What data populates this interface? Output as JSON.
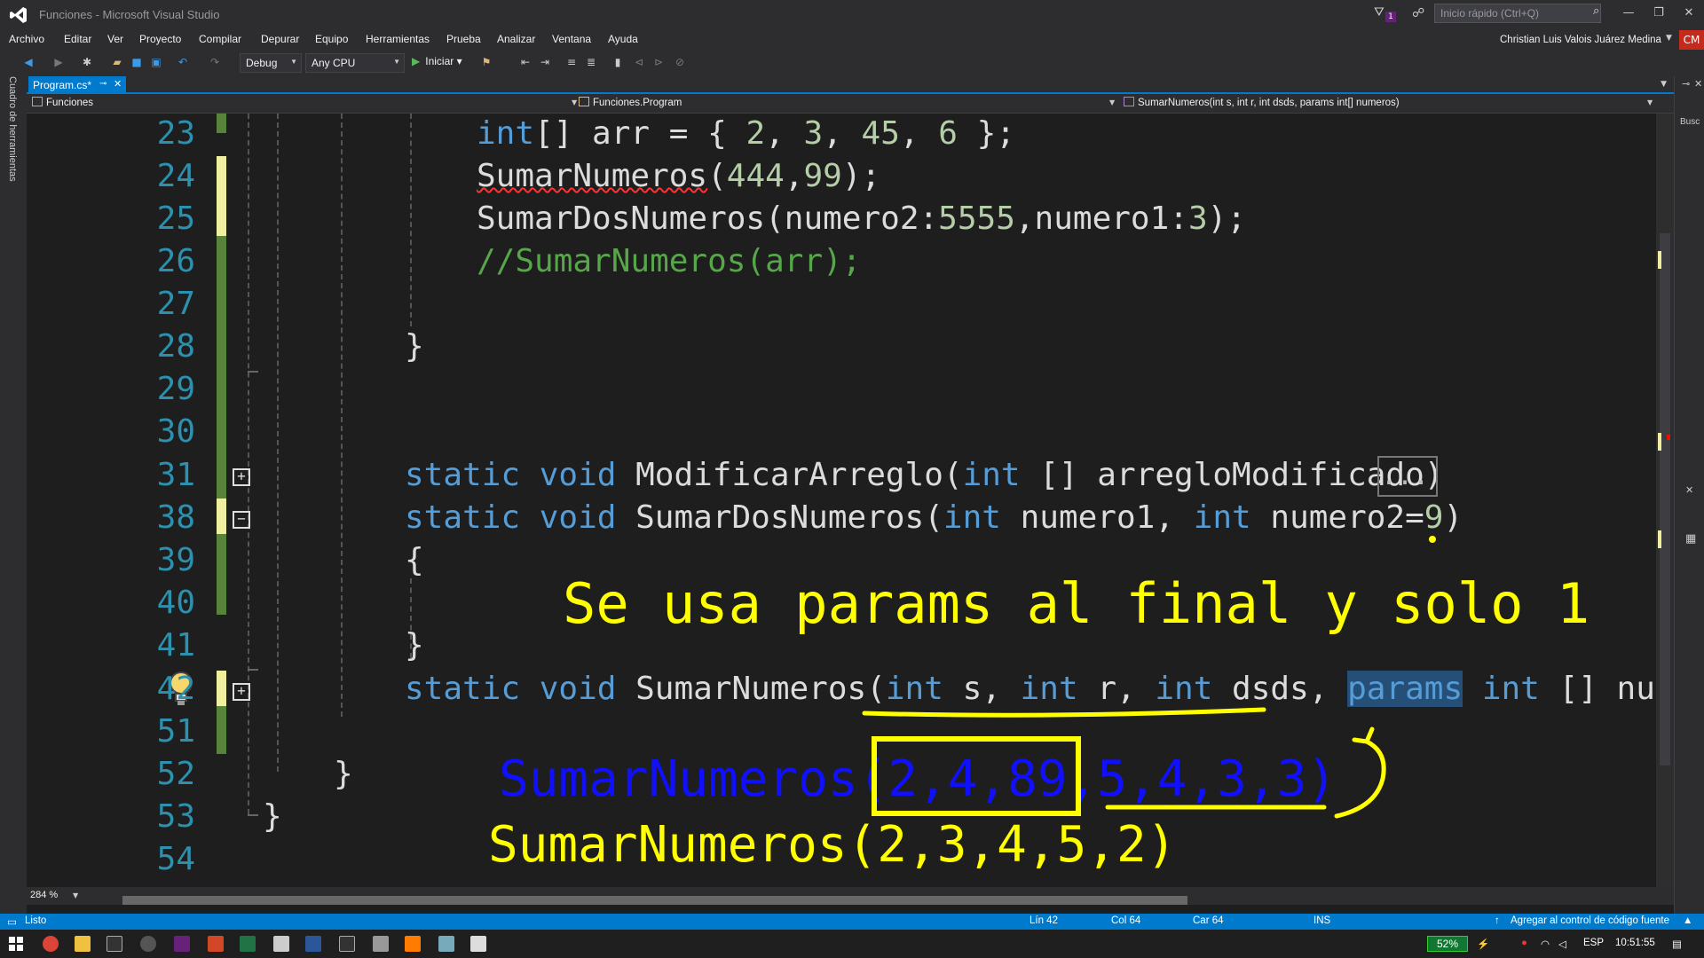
{
  "window": {
    "title": "Funciones - Microsoft Visual Studio",
    "quick_launch_placeholder": "Inicio rápido (Ctrl+Q)",
    "notification_count": "1"
  },
  "menu": [
    "Archivo",
    "Editar",
    "Ver",
    "Proyecto",
    "Compilar",
    "Depurar",
    "Equipo",
    "Herramientas",
    "Prueba",
    "Analizar",
    "Ventana",
    "Ayuda"
  ],
  "user": {
    "name": "Christian Luis Valois Juárez Medina",
    "initials": "CM"
  },
  "toolbar": {
    "config": "Debug",
    "platform": "Any CPU",
    "start_label": "Iniciar"
  },
  "toolbox_label": "Cuadro de herramientas",
  "tab": {
    "label": "Program.cs*"
  },
  "navbar": {
    "project": "Funciones",
    "class": "Funciones.Program",
    "member": "SumarNumeros(int s, int r, int dsds, params int[] numeros)"
  },
  "right_panel_label": "Busc",
  "editor": {
    "line_numbers": [
      "23",
      "24",
      "25",
      "26",
      "27",
      "28",
      "29",
      "30",
      "31",
      "38",
      "39",
      "40",
      "41",
      "42",
      "51",
      "52",
      "53",
      "54"
    ],
    "lines": {
      "l23": {
        "a": "int",
        "b": "[] arr = { ",
        "c": "2",
        "d": ", ",
        "e": "3",
        "f": ", ",
        "g": "45",
        "h": ", ",
        "i": "6",
        "j": " };"
      },
      "l24": {
        "a": "SumarNumeros",
        "b": "(",
        "c": "444",
        "d": ",",
        "e": "99",
        "f": ");"
      },
      "l25": {
        "a": "SumarDosNumeros(numero2:",
        "b": "5555",
        "c": ",numero1:",
        "d": "3",
        "e": ");"
      },
      "l26": "//SumarNumeros(arr);",
      "l28": "}",
      "l31": {
        "a": "static",
        "b": " ",
        "c": "void",
        "d": " ModificarArreglo(",
        "e": "int",
        "f": " [] arregloModificado)",
        "collapsed": "..."
      },
      "l38": {
        "a": "static",
        "b": " ",
        "c": "void",
        "d": " SumarDosNumeros(",
        "e": "int",
        "f": " numero1, ",
        "g": "int",
        "h": " numero2=",
        "i": "9",
        "j": ")"
      },
      "l39": "{",
      "l41": "}",
      "l42": {
        "a": "static",
        "b": " ",
        "c": "void",
        "d": " SumarNumeros(",
        "e": "int",
        "f": " s, ",
        "g": "int",
        "h": " r, ",
        "i": "int",
        "j": " dsds, ",
        "k": "params",
        "l": " ",
        "m": "int",
        "n": " [] numero"
      },
      "l52": "}",
      "l53": "}"
    }
  },
  "annotations": {
    "note": "Se usa params al final y solo 1",
    "blue_call": "SumarNumeros(2,4,89,5,4,3,3)",
    "yellow_call": "SumarNumeros(2,3,4,5,2)"
  },
  "zoom": "284 %",
  "status": {
    "state": "Listo",
    "line": "Lín 42",
    "col": "Col 64",
    "car": "Car 64",
    "mode": "INS",
    "source_control": "Agregar al control de código fuente"
  },
  "taskbar": {
    "battery": "52%",
    "lang": "ESP",
    "time": "10:51:55"
  },
  "colors": {
    "accent": "#007acc",
    "keyword": "#569cd6",
    "number": "#b5cea8",
    "comment": "#57a64a",
    "annotation_yellow": "#ffff00",
    "annotation_blue": "#1010ff"
  }
}
